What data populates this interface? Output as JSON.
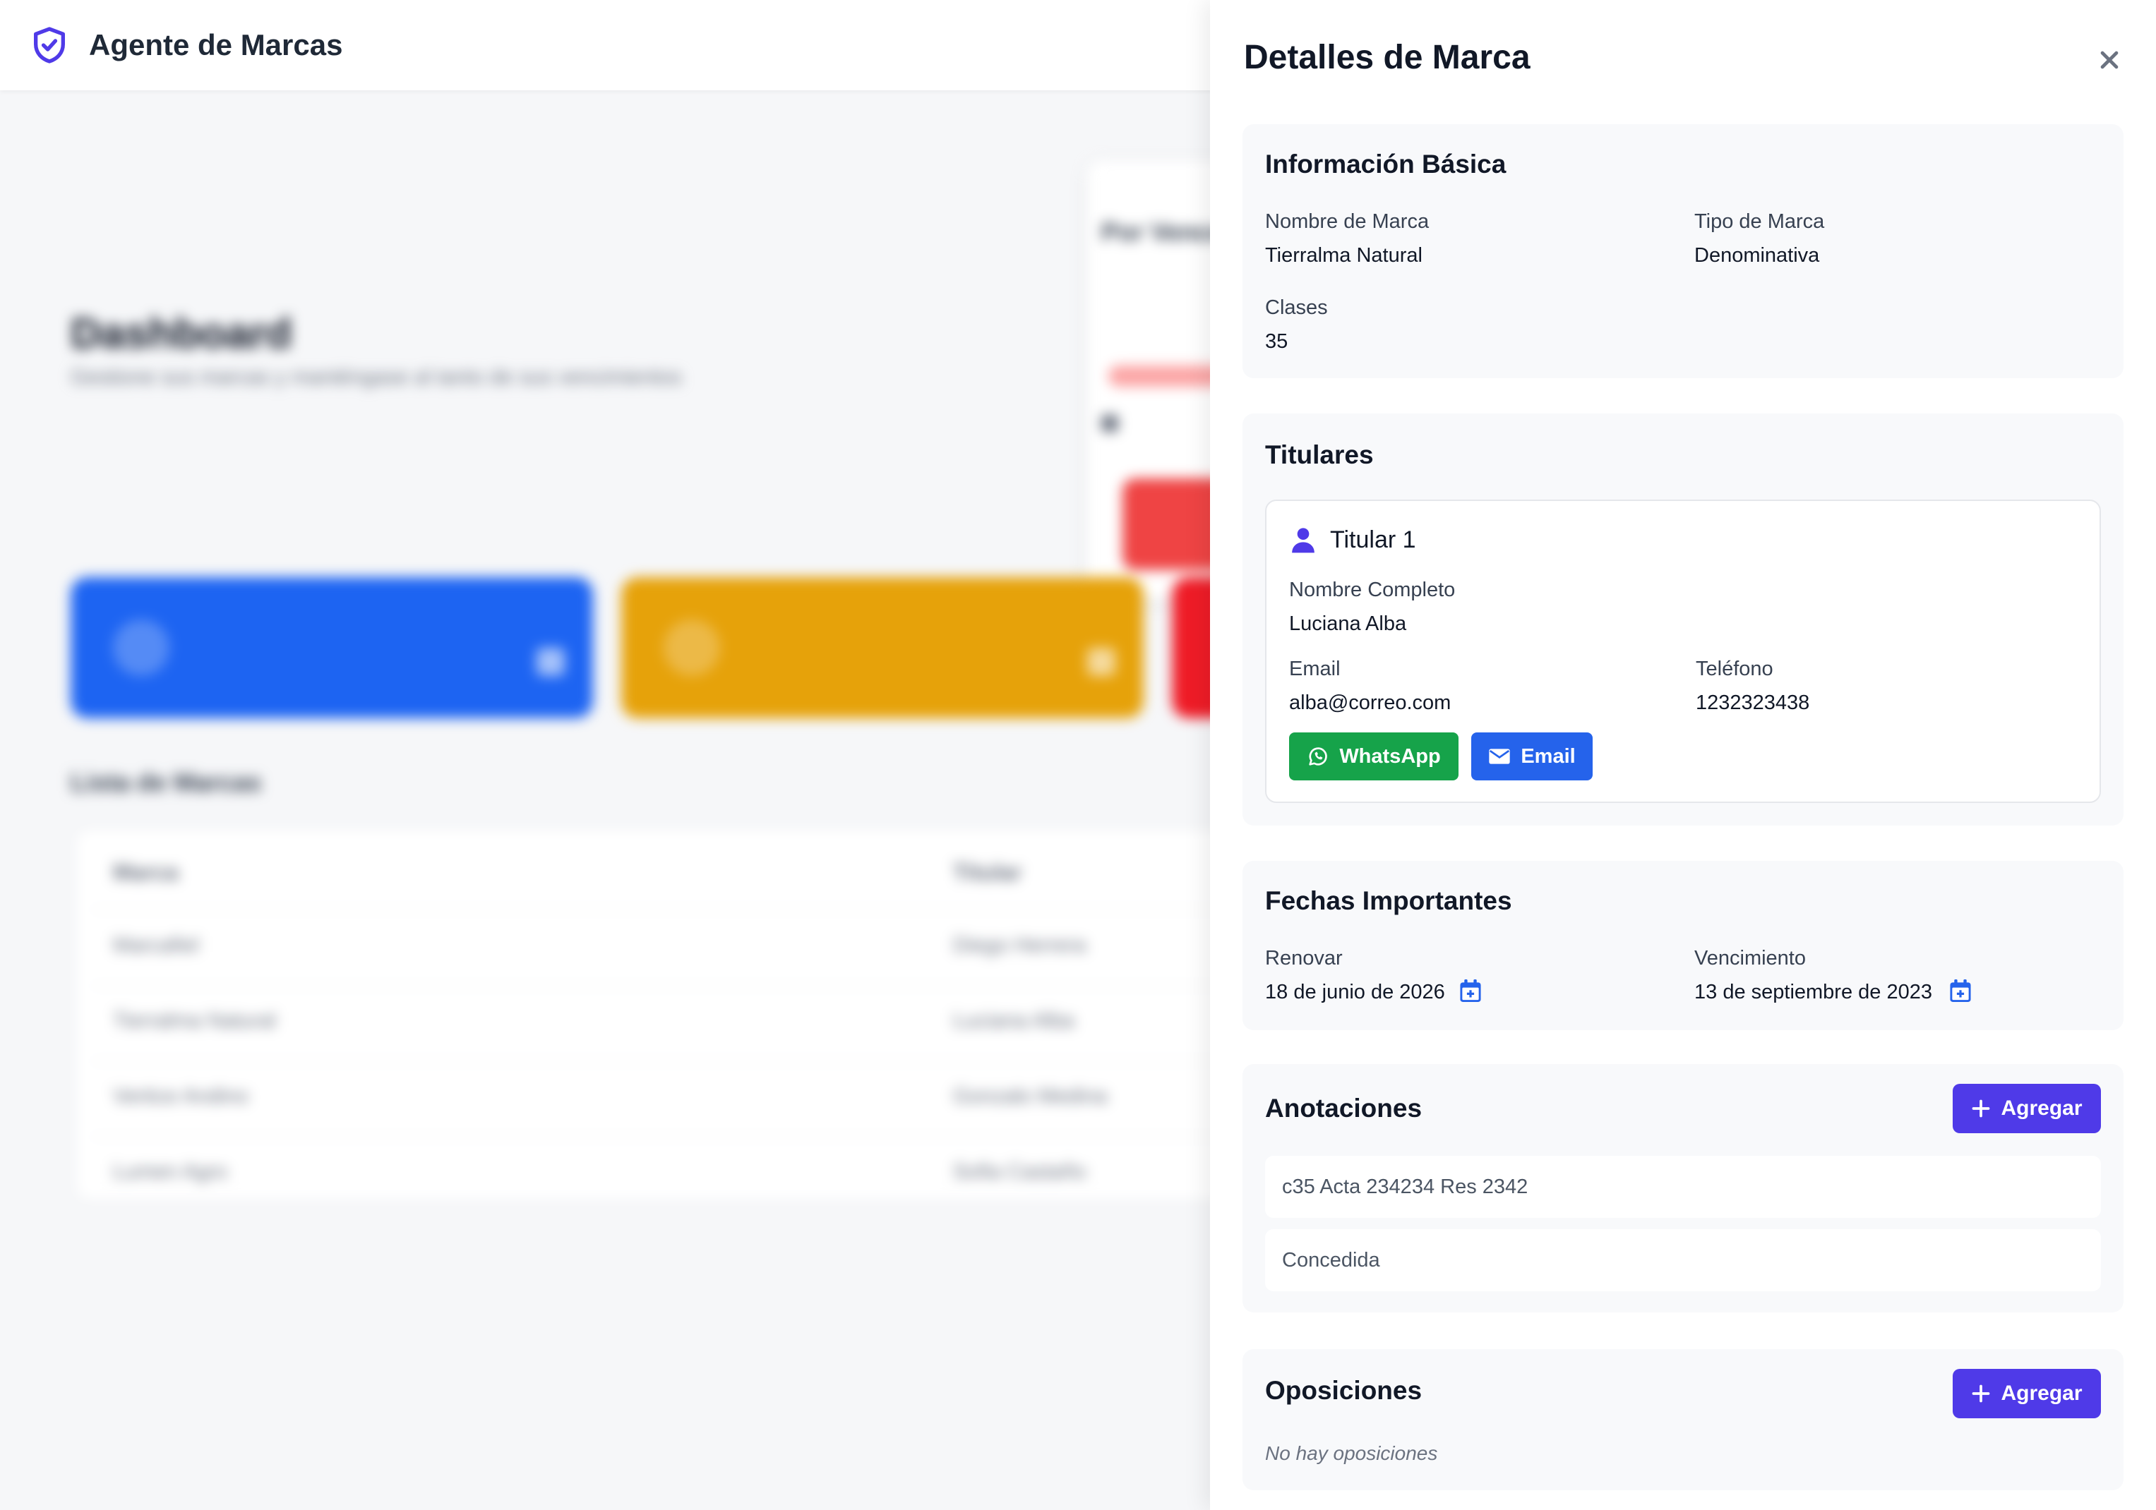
{
  "app": {
    "title": "Agente de Marcas"
  },
  "background": {
    "dashboard_title": "Dashboard",
    "dashboard_subtitle": "Gestione sus marcas y manténgase al tanto de sus vencimientos",
    "status_card_title": "Por Vencer",
    "list_title": "Lista de Marcas",
    "table_headers": [
      "Marca",
      "Titular"
    ],
    "table_rows": [
      [
        "Marcafiel",
        "Diego Herrera"
      ],
      [
        "Tierralma Natural",
        "Luciana Alba"
      ],
      [
        "Vertice Andino",
        "Gonzalo Medina"
      ],
      [
        "Lumen Agro",
        "Sofia Castaño"
      ]
    ]
  },
  "panel": {
    "title": "Detalles de Marca",
    "basic": {
      "title": "Información Básica",
      "brand_name_label": "Nombre de Marca",
      "brand_name": "Tierralma Natural",
      "brand_type_label": "Tipo de Marca",
      "brand_type": "Denominativa",
      "classes_label": "Clases",
      "classes": "35"
    },
    "holders": {
      "title": "Titulares",
      "items": [
        {
          "title": "Titular 1",
          "full_name_label": "Nombre Completo",
          "full_name": "Luciana Alba",
          "email_label": "Email",
          "email": "alba@correo.com",
          "phone_label": "Teléfono",
          "phone": "1232323438",
          "whatsapp_button": "WhatsApp",
          "email_button": "Email"
        }
      ]
    },
    "dates": {
      "title": "Fechas Importantes",
      "renew_label": "Renovar",
      "renew_date": "18 de junio de 2026",
      "expiry_label": "Vencimiento",
      "expiry_date": "13 de septiembre de 2023"
    },
    "annotations": {
      "title": "Anotaciones",
      "add_button": "Agregar",
      "items": [
        "c35 Acta 234234 Res 2342",
        "Concedida"
      ]
    },
    "oppositions": {
      "title": "Oposiciones",
      "add_button": "Agregar",
      "empty_text": "No hay oposiciones"
    }
  },
  "colors": {
    "accent": "#4f3ae8",
    "whatsapp": "#16a34a",
    "email": "#2563eb",
    "calendar": "#2563eb"
  }
}
